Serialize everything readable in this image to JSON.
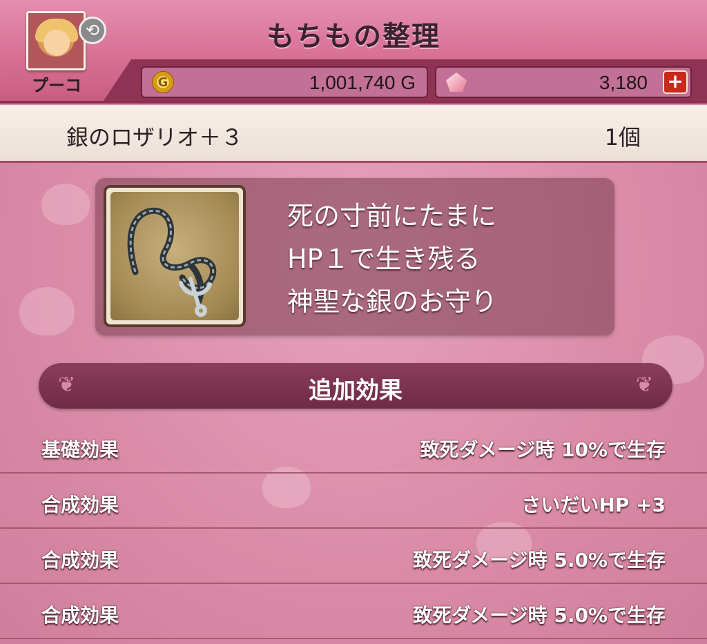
{
  "header": {
    "title": "もちもの整理",
    "character_name": "プーコ",
    "gold": "1,001,740 G",
    "gold_icon_glyph": "G",
    "gems": "3,180",
    "add_button_glyph": "+"
  },
  "item": {
    "name": "銀のロザリオ＋３",
    "count": "1個",
    "description_lines": [
      "死の寸前にたまに",
      "HP１で生き残る",
      "神聖な銀のお守り"
    ]
  },
  "effects": {
    "section_title": "追加効果",
    "rows": [
      {
        "label": "基礎効果",
        "value": "致死ダメージ時  10%で生存"
      },
      {
        "label": "合成効果",
        "value": "さいだいHP  +3"
      },
      {
        "label": "合成効果",
        "value": "致死ダメージ時  5.0%で生存"
      },
      {
        "label": "合成効果",
        "value": "致死ダメージ時  5.0%で生存"
      }
    ]
  },
  "colors": {
    "header_bg": "#d87195",
    "header_border": "#8c2f4f",
    "section_bar": "#7a3350",
    "content_bg": "#d98aa6",
    "add_button": "#c62a1c"
  },
  "icons": {
    "switch": "swap-arrows-icon",
    "gold": "gold-coin-icon",
    "gem": "gem-icon",
    "item": "silver-rosary-icon"
  }
}
